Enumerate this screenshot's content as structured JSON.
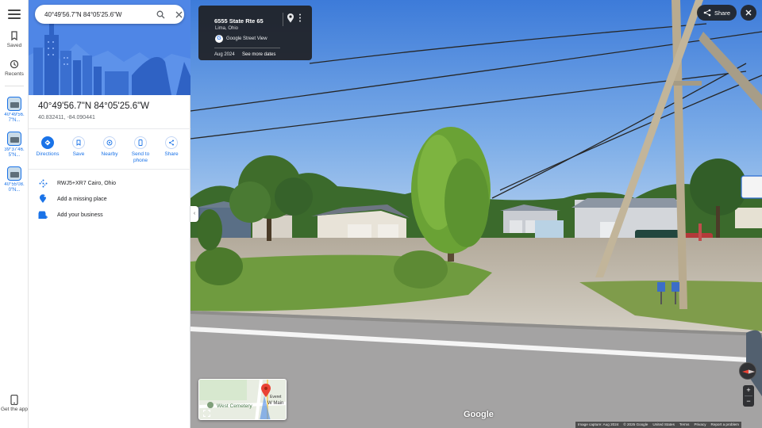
{
  "search": {
    "value": "40°49'56.7\"N 84°05'25.6\"W"
  },
  "rail": {
    "saved_label": "Saved",
    "recents_label": "Recents",
    "recent_items": [
      "40°49'56.7\"N...",
      "39°37'46.5\"N...",
      "40°55'08.0\"N..."
    ],
    "get_app_label": "Get the app"
  },
  "place": {
    "title": "40°49'56.7\"N 84°05'25.6\"W",
    "decimal": "40.832411, -84.090441"
  },
  "actions": [
    {
      "label": "Directions",
      "icon": "directions-icon"
    },
    {
      "label": "Save",
      "icon": "bookmark-icon"
    },
    {
      "label": "Nearby",
      "icon": "nearby-icon"
    },
    {
      "label": "Send to phone",
      "icon": "phone-icon"
    },
    {
      "label": "Share",
      "icon": "share-icon"
    }
  ],
  "details": {
    "plus_code": "RWJ5+XR7 Cairo, Ohio",
    "add_place": "Add a missing place",
    "add_business": "Add your business"
  },
  "streetview": {
    "address": "6555 State Rte 65",
    "city": "Lima, Ohio",
    "source": "Google Street View",
    "date": "Aug 2024",
    "more_dates": "See more dates",
    "share_label": "Share",
    "google_logo": "Google",
    "minimap": {
      "cemetery": "West Cemetery",
      "road": "W Main",
      "other": "Everet"
    },
    "footer": [
      "Image capture: Aug 2024",
      "© 2025 Google",
      "United States",
      "Terms",
      "Privacy",
      "Report a problem"
    ]
  },
  "colors": {
    "accent": "#1a73e8",
    "hero": "#4f86e6",
    "card": "#202124"
  }
}
